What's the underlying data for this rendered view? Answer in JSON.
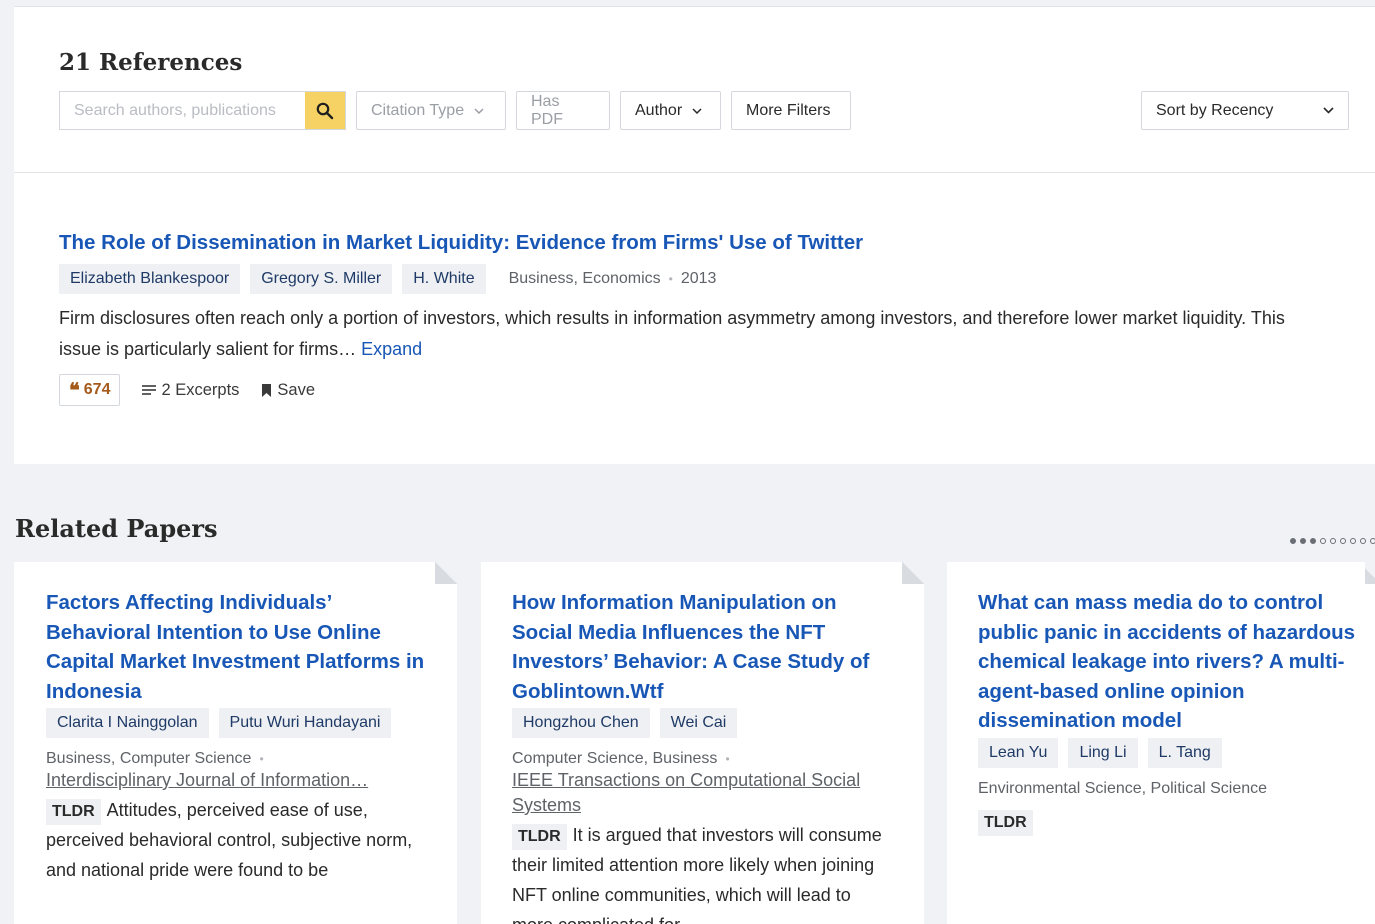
{
  "references": {
    "title": "21 References",
    "search_placeholder": "Search authors, publications",
    "filters": {
      "citation_type": "Citation Type",
      "has_pdf": "Has PDF",
      "author": "Author",
      "more_filters": "More Filters"
    },
    "sort": {
      "label": "Sort by Recency"
    }
  },
  "paper": {
    "title": "The Role of Dissemination in Market Liquidity: Evidence from Firms' Use of Twitter",
    "authors": [
      "Elizabeth Blankespoor",
      "Gregory S. Miller",
      "H. White"
    ],
    "fields": "Business, Economics",
    "year": "2013",
    "abstract": "Firm disclosures often reach only a portion of investors, which results in information asymmetry among investors, and therefore lower market liquidity. This issue is particularly salient for firms…",
    "expand_label": "Expand",
    "citations": "674",
    "excerpts": "2 Excerpts",
    "save": "Save"
  },
  "related": {
    "title": "Related Papers",
    "carousel": {
      "total": 9,
      "active": 3
    },
    "cards": [
      {
        "title": "Factors Affecting Individuals’ Behavioral Intention to Use Online Capital Market Investment Platforms in Indonesia",
        "authors": [
          "Clarita I Nainggolan",
          "Putu Wuri Handayani"
        ],
        "fields": "Business, Computer Science",
        "venue": "Interdisciplinary Journal of Information…",
        "tldr_label": "TLDR",
        "tldr": "Attitudes, perceived ease of use, perceived behavioral control, subjective norm, and national pride were found to be"
      },
      {
        "title": "How Information Manipulation on Social Media Influences the NFT Investors’ Behavior: A Case Study of Goblintown.Wtf",
        "authors": [
          "Hongzhou Chen",
          "Wei Cai"
        ],
        "fields": "Computer Science, Business",
        "venue": "IEEE Transactions on Computational Social Systems",
        "tldr_label": "TLDR",
        "tldr": "It is argued that investors will consume their limited attention more likely when joining NFT online communities, which will lead to more complicated for"
      },
      {
        "title": "What can mass media do to control public panic in accidents of hazardous chemical leakage into rivers? A multi-agent-based online opinion dissemination model",
        "authors": [
          "Lean Yu",
          "Ling Li",
          "L. Tang"
        ],
        "fields": "Environmental Science, Political Science",
        "venue": "",
        "tldr_label": "TLDR",
        "tldr": ""
      }
    ]
  }
}
